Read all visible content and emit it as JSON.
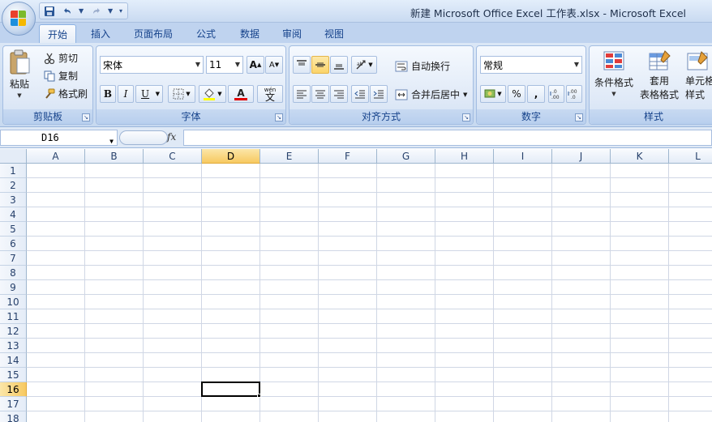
{
  "window": {
    "title": "新建 Microsoft Office Excel 工作表.xlsx - Microsoft Excel"
  },
  "tabs": [
    {
      "label": "开始",
      "active": true
    },
    {
      "label": "插入"
    },
    {
      "label": "页面布局"
    },
    {
      "label": "公式"
    },
    {
      "label": "数据"
    },
    {
      "label": "审阅"
    },
    {
      "label": "视图"
    }
  ],
  "clipboard": {
    "paste": "粘贴",
    "cut": "剪切",
    "copy": "复制",
    "format_painter": "格式刷",
    "label": "剪贴板"
  },
  "font": {
    "name": "宋体",
    "size": "11",
    "bold": "B",
    "italic": "I",
    "underline": "U",
    "grow": "A",
    "shrink": "A",
    "color_letter": "A",
    "wen": "文",
    "wen_top": "wén",
    "label": "字体"
  },
  "alignment": {
    "wrap": "自动换行",
    "merge": "合并后居中",
    "label": "对齐方式"
  },
  "number": {
    "format": "常规",
    "percent": "%",
    "comma": ",",
    "label": "数字"
  },
  "styles": {
    "conditional": "条件格式",
    "table_line1": "套用",
    "table_line2": "表格格式",
    "cell_line1": "单元格",
    "cell_line2": "样式",
    "label": "样式"
  },
  "formula_bar": {
    "name_box": "D16",
    "fx": "fx",
    "value": ""
  },
  "grid": {
    "columns": [
      "A",
      "B",
      "C",
      "D",
      "E",
      "F",
      "G",
      "H",
      "I",
      "J",
      "K",
      "L"
    ],
    "rows": [
      "1",
      "2",
      "3",
      "4",
      "5",
      "6",
      "7",
      "8",
      "9",
      "10",
      "11",
      "12",
      "13",
      "14",
      "15",
      "16",
      "17",
      "18"
    ],
    "active_col": "D",
    "active_row": "16"
  },
  "colors": {
    "accent": "#15428b",
    "selection": "#f7c961",
    "gridline": "#d0d7e5"
  }
}
